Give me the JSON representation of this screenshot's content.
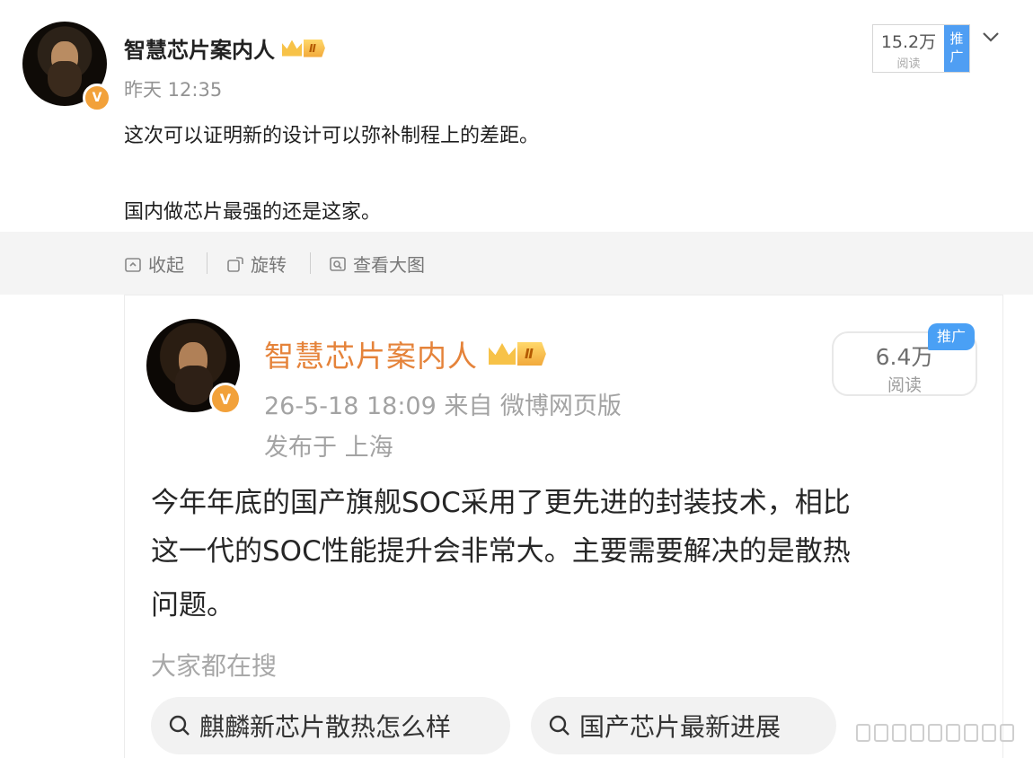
{
  "post": {
    "author": "智慧芯片案内人",
    "vip_level": "Ⅱ",
    "verified_mark": "V",
    "time": "昨天 12:35",
    "text_line1": "这次可以证明新的设计可以弥补制程上的差距。",
    "text_line2": "国内做芯片最强的还是这家。",
    "reads_value": "15.2万",
    "reads_label": "阅读",
    "promo_label": "推广"
  },
  "toolbar": {
    "collapse": "收起",
    "rotate": "旋转",
    "view_large": "查看大图"
  },
  "embedded": {
    "author": "智慧芯片案内人",
    "vip_level": "Ⅱ",
    "verified_mark": "V",
    "time_source": "26-5-18 18:09  来自 微博网页版",
    "location": "发布于 上海",
    "reads_value": "6.4万",
    "reads_label": "阅读",
    "promo_label": "推广",
    "text_line1": "今年年底的国产旗舰SOC采用了更先进的封装技术，相比",
    "text_line2": "这一代的SOC性能提升会非常大。主要需要解决的是散热",
    "text_line3": "问题。",
    "search_label": "大家都在搜",
    "search_chips": [
      "麒麟新芯片散热怎么样",
      "国产芯片最新进展"
    ]
  },
  "colors": {
    "embedded_name": "#e5833a",
    "verified_badge": "#f2a13a",
    "promo_blue": "#4f9ef3"
  },
  "icons": [
    "collapse-icon",
    "rotate-icon",
    "view-large-icon",
    "search-icon",
    "chevron-down-icon",
    "crown-icon"
  ]
}
